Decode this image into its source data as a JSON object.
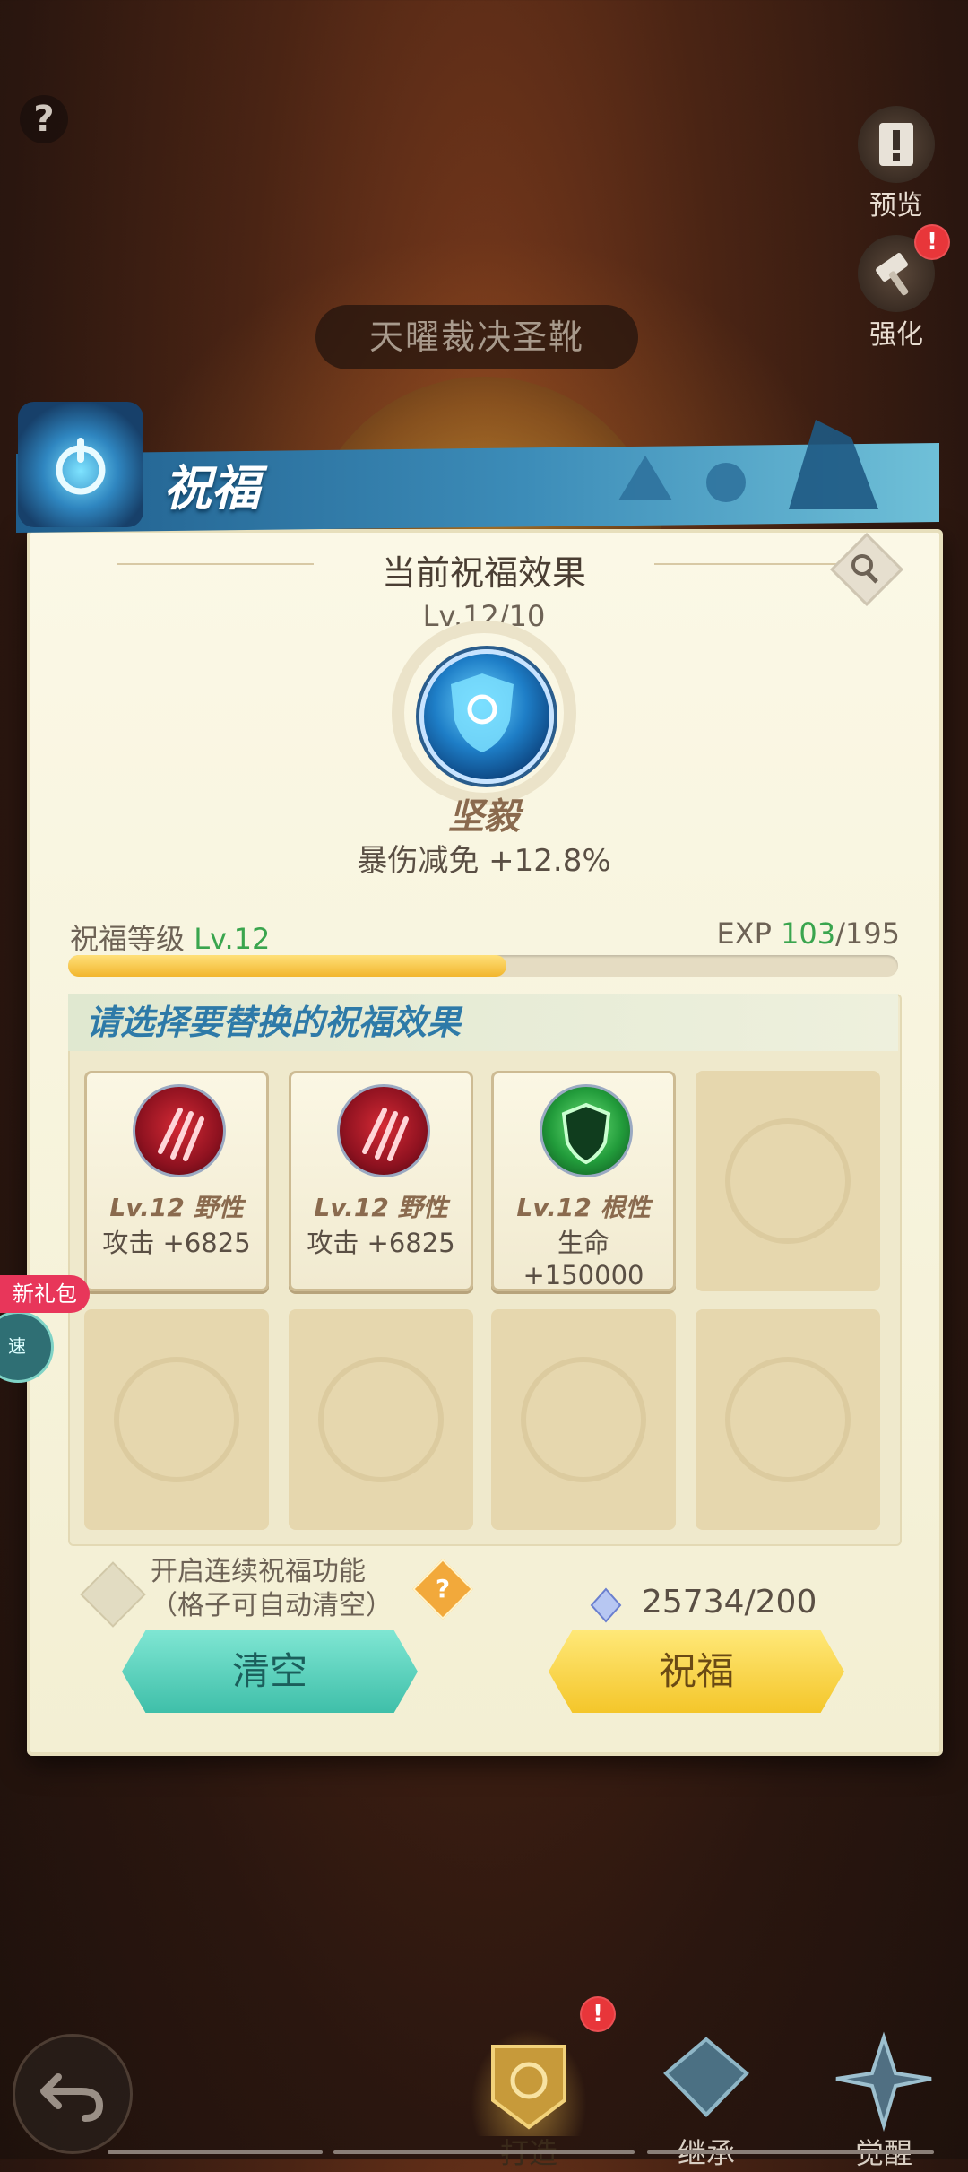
{
  "top": {
    "help_label": "?",
    "item_title": "天曜裁决圣靴",
    "preview_label": "预览",
    "enhance_label": "强化",
    "enhance_badge": "!"
  },
  "panel": {
    "title": "祝福",
    "current_section_title": "当前祝福效果",
    "current_level": "Lv.12/10",
    "effect_name": "坚毅",
    "effect_stat": "暴伤减免 +12.8%",
    "bless_level_label": "祝福等级",
    "bless_level_value": "Lv.12",
    "exp_label": "EXP",
    "exp_current": "103",
    "exp_max": "/195",
    "exp_progress": 0.528,
    "choose_title": "请选择要替换的祝福效果",
    "slots": [
      {
        "name": "Lv.12 野性",
        "stat": "攻击 +6825",
        "icon": "claw-icon"
      },
      {
        "name": "Lv.12 野性",
        "stat": "攻击 +6825",
        "icon": "claw-icon"
      },
      {
        "name": "Lv.12 根性",
        "stat": "生命 +150000",
        "icon": "shield-crest-icon"
      }
    ],
    "auto_line1": "开启连续祝福功能",
    "auto_line2": "（格子可自动清空）",
    "q_label": "?",
    "cost": "25734/200",
    "clear_button": "清空",
    "bless_button": "祝福"
  },
  "side": {
    "gift_tag": "新礼包",
    "speed_label": "速"
  },
  "tabs": [
    {
      "label": "打造",
      "active": true
    },
    {
      "label": "继承",
      "active": false
    },
    {
      "label": "觉醒",
      "active": false
    }
  ],
  "tab_badge": "!",
  "colors": {
    "accent_green": "#3aa54e",
    "banner_blue": "#2f7fb0",
    "button_teal": "#5ad0bd",
    "button_yellow": "#f8d84a"
  }
}
